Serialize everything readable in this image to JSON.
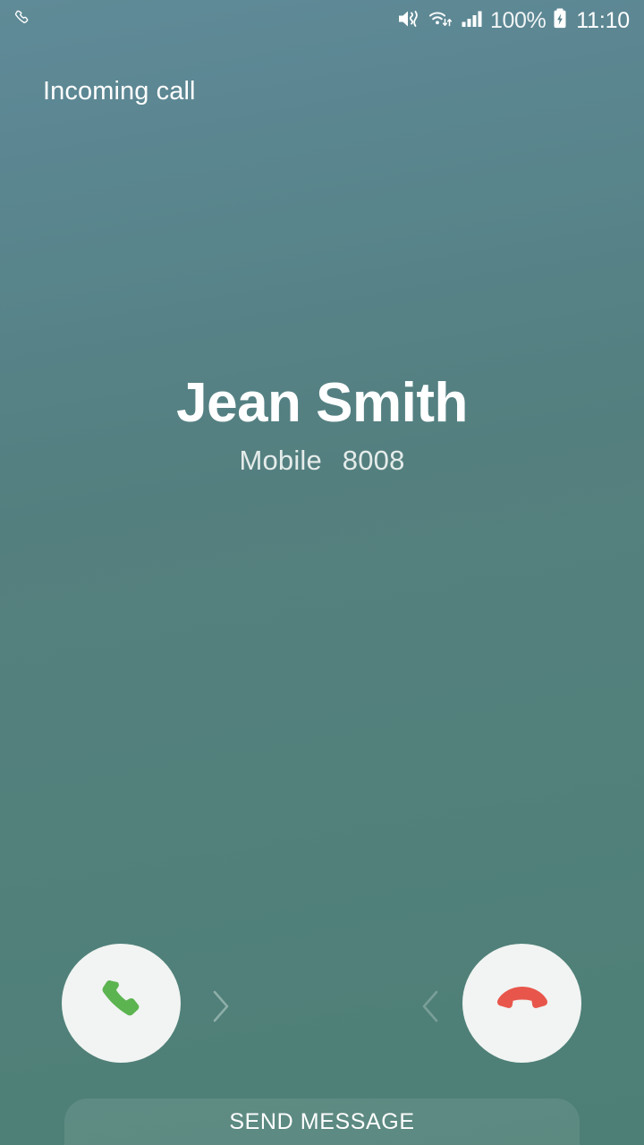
{
  "status_bar": {
    "left_icons": [
      {
        "name": "phone-call-icon",
        "glyph": "phone"
      }
    ],
    "right_icons": [
      {
        "name": "sound-vibrate-mute-icon",
        "glyph": "mute-vibrate"
      },
      {
        "name": "wifi-icon",
        "glyph": "wifi-transfer"
      },
      {
        "name": "signal-bars-icon",
        "glyph": "signal"
      }
    ],
    "battery_percent": "100%",
    "battery_state_icon": "battery-charging-icon",
    "clock": "11:10"
  },
  "header": {
    "call_state": "Incoming call"
  },
  "caller": {
    "name": "Jean Smith",
    "number_label": "Mobile",
    "number_value": "8008"
  },
  "actions": {
    "answer": {
      "label": "Answer",
      "icon": "phone-answer-icon",
      "icon_color": "#5cb450"
    },
    "decline": {
      "label": "Decline",
      "icon": "phone-hangup-icon",
      "icon_color": "#e8564b"
    },
    "answer_hint_icon": "chevron-right-icon",
    "decline_hint_icon": "chevron-left-icon"
  },
  "send_message": {
    "label": "SEND MESSAGE"
  },
  "colors": {
    "background_top": "#5f8a97",
    "background_bottom": "#4d7f76",
    "circle_fill": "#f1f4f2",
    "answer_green": "#5cb450",
    "decline_red": "#e8564b",
    "text_primary": "#ffffff",
    "text_secondary": "#e4ecea"
  }
}
